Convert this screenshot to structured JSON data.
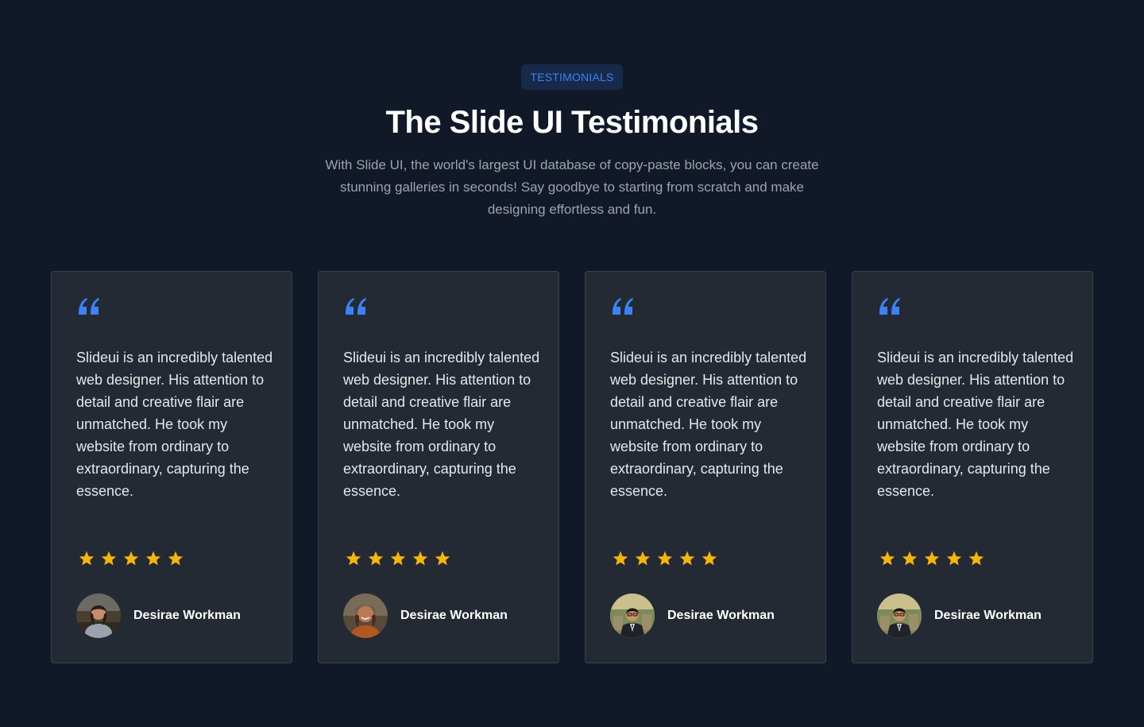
{
  "header": {
    "badge": "TESTIMONIALS",
    "title": "The Slide UI Testimonials",
    "subtitle": "With Slide UI, the world's largest UI database of copy-paste blocks, you can create stunning galleries in seconds! Say goodbye to starting from scratch and make designing effortless and fun."
  },
  "colors": {
    "background": "#111827",
    "card": "#232a33",
    "accent": "#3b82f6",
    "star": "#f5b50a"
  },
  "testimonials": [
    {
      "quote_icon": "quote-icon",
      "text": "Slideui is an incredibly talented web designer. His attention to detail and creative flair are unmatched. He took my website from ordinary to extraordinary, capturing the essence.",
      "rating": 5,
      "author": "Desirae Workman"
    },
    {
      "quote_icon": "quote-icon",
      "text": "Slideui is an incredibly talented web designer. His attention to detail and creative flair are unmatched. He took my website from ordinary to extraordinary, capturing the essence.",
      "rating": 5,
      "author": "Desirae Workman"
    },
    {
      "quote_icon": "quote-icon",
      "text": "Slideui is an incredibly talented web designer. His attention to detail and creative flair are unmatched. He took my website from ordinary to extraordinary, capturing the essence.",
      "rating": 5,
      "author": "Desirae Workman"
    },
    {
      "quote_icon": "quote-icon",
      "text": "Slideui is an incredibly talented web designer. His attention to detail and creative flair are unmatched. He took my website from ordinary to extraordinary, capturing the essence.",
      "rating": 5,
      "author": "Desirae Workman"
    }
  ]
}
